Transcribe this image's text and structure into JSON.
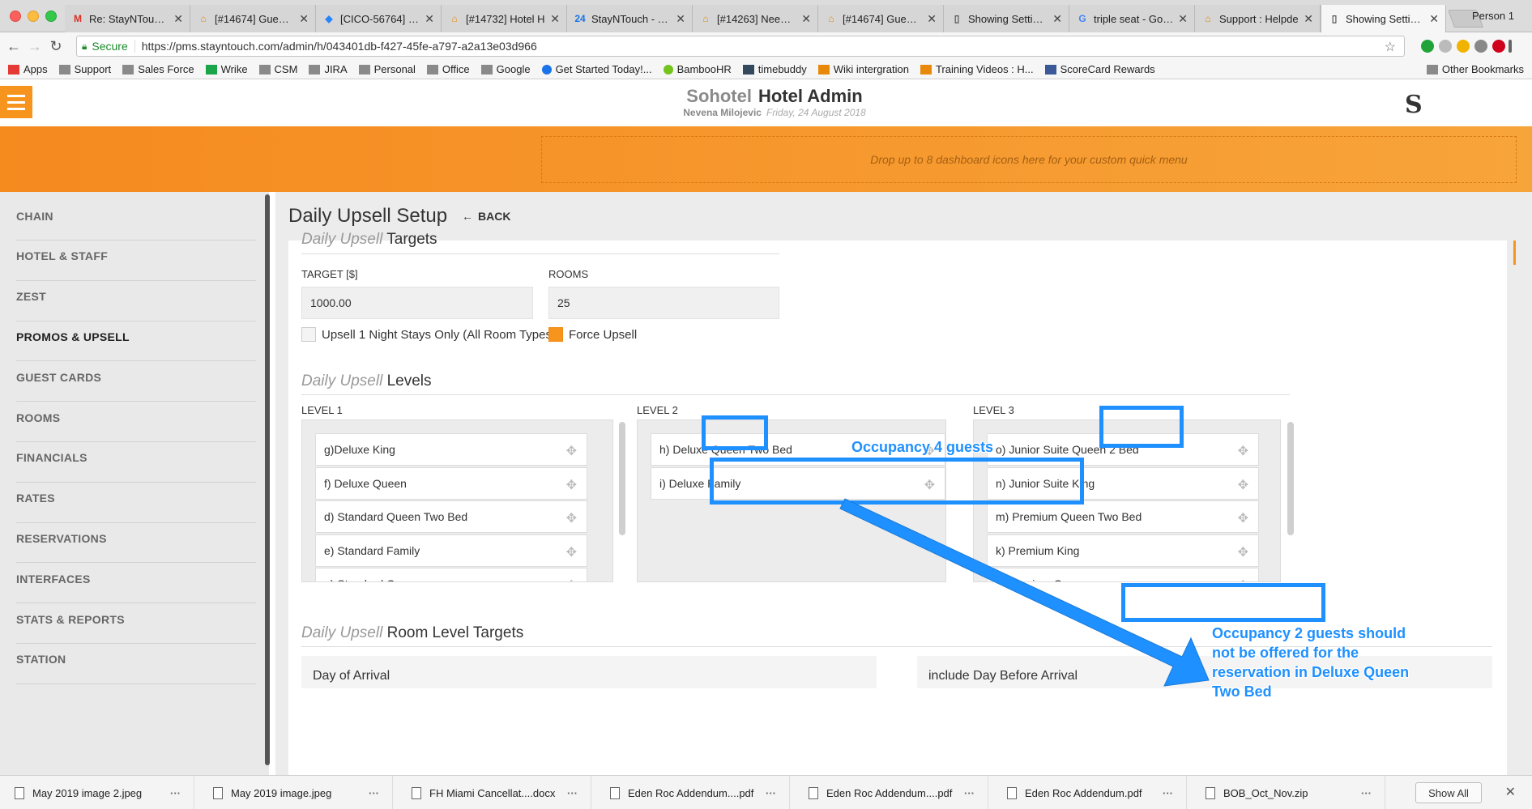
{
  "browser": {
    "tabs": [
      {
        "label": "Re: StayNTouch T",
        "icon": "gmail-icon",
        "icon_glyph": "M",
        "icon_color": "#d93025"
      },
      {
        "label": "[#14674] Guest d",
        "icon": "helpdesk-icon",
        "icon_glyph": "⌂",
        "icon_color": "#e8890c"
      },
      {
        "label": "[CICO-56764] Ho",
        "icon": "jira-icon",
        "icon_glyph": "◆",
        "icon_color": "#2684ff"
      },
      {
        "label": "[#14732] Hotel H",
        "icon": "helpdesk-icon",
        "icon_glyph": "⌂",
        "icon_color": "#e8890c"
      },
      {
        "label": "StayNTouch - Fric",
        "icon": "calendar-icon",
        "icon_glyph": "24",
        "icon_color": "#1a73e8"
      },
      {
        "label": "[#14263] Need to",
        "icon": "helpdesk-icon",
        "icon_glyph": "⌂",
        "icon_color": "#e8890c"
      },
      {
        "label": "[#14674] Guest d",
        "icon": "helpdesk-icon",
        "icon_glyph": "⌂",
        "icon_color": "#e8890c"
      },
      {
        "label": "Showing Settings",
        "icon": "document-icon",
        "icon_glyph": "▯",
        "icon_color": "#555555"
      },
      {
        "label": "triple seat - Goog",
        "icon": "google-icon",
        "icon_glyph": "G",
        "icon_color": "#4285f4"
      },
      {
        "label": "Support : Helpde",
        "icon": "helpdesk-icon",
        "icon_glyph": "⌂",
        "icon_color": "#e8890c"
      },
      {
        "label": "Showing Settings",
        "icon": "document-icon",
        "icon_glyph": "▯",
        "icon_color": "#555555",
        "active": true
      }
    ],
    "profile": "Person 1",
    "secure_label": "Secure",
    "url": "https://pms.stayntouch.com/admin/h/043401db-f427-45fe-a797-a2a13e03d966",
    "bookmarks": [
      {
        "label": "Apps",
        "icon": "apps-grid-icon"
      },
      {
        "label": "Support",
        "icon": "folder-icon"
      },
      {
        "label": "Sales Force",
        "icon": "folder-icon"
      },
      {
        "label": "Wrike",
        "icon": "checkmark-icon"
      },
      {
        "label": "CSM",
        "icon": "folder-icon"
      },
      {
        "label": "JIRA",
        "icon": "folder-icon"
      },
      {
        "label": "Personal",
        "icon": "folder-icon"
      },
      {
        "label": "Office",
        "icon": "folder-icon"
      },
      {
        "label": "Google",
        "icon": "folder-icon"
      },
      {
        "label": "Get Started Today!...",
        "icon": "search-icon"
      },
      {
        "label": "BambooHR",
        "icon": "bamboo-icon"
      },
      {
        "label": "timebuddy",
        "icon": "clock-icon"
      },
      {
        "label": "Wiki intergration",
        "icon": "helpdesk-icon"
      },
      {
        "label": "Training Videos : H...",
        "icon": "helpdesk-icon"
      },
      {
        "label": "ScoreCard Rewards",
        "icon": "scorecard-icon"
      }
    ],
    "other_bookmarks": "Other Bookmarks"
  },
  "header": {
    "hotel": "Sohotel",
    "title": "Hotel Admin",
    "user": "Nevena Milojevic",
    "date": "Friday, 24 August 2018",
    "drop_zone": "Drop up to 8 dashboard icons here for your custom quick menu"
  },
  "sidebar": {
    "items": [
      {
        "label": "CHAIN"
      },
      {
        "label": "HOTEL & STAFF"
      },
      {
        "label": "ZEST"
      },
      {
        "label": "PROMOS & UPSELL",
        "active": true
      },
      {
        "label": "GUEST CARDS"
      },
      {
        "label": "ROOMS"
      },
      {
        "label": "FINANCIALS"
      },
      {
        "label": "RATES"
      },
      {
        "label": "RESERVATIONS"
      },
      {
        "label": "INTERFACES"
      },
      {
        "label": "STATS & REPORTS"
      },
      {
        "label": "STATION"
      }
    ]
  },
  "page": {
    "title": "Daily Upsell Setup",
    "back": "BACK",
    "targets_title_light": "Daily Upsell",
    "targets_title": "Targets",
    "target_label": "TARGET [$]",
    "target_value": "1000.00",
    "rooms_label": "ROOMS",
    "rooms_value": "25",
    "night_stays_label": "Upsell 1 Night Stays Only (All Room Types)",
    "force_upsell_label": "Force Upsell",
    "levels_title_light": "Daily Upsell",
    "levels_title": "Levels",
    "levels": [
      {
        "label": "LEVEL 1",
        "items": [
          "g)Deluxe King",
          "f) Deluxe Queen",
          "d) Standard Queen Two Bed",
          "e) Standard Family",
          "a) Standard Queen"
        ]
      },
      {
        "label": "LEVEL 2",
        "items": [
          "h) Deluxe Queen Two Bed",
          "i) Deluxe Family"
        ]
      },
      {
        "label": "LEVEL 3",
        "items": [
          "o) Junior Suite Queen 2 Bed",
          "n) Junior Suite King",
          "m) Premium Queen Two Bed",
          "k) Premium King",
          "i) Premium Queen"
        ]
      }
    ],
    "room_targets_title_light": "Daily Upsell",
    "room_targets_title": "Room Level Targets",
    "day_of_arrival": "Day of Arrival",
    "day_before_arrival": "include Day Before Arrival"
  },
  "annotations": {
    "occupancy_4": "Occupancy 4 guests",
    "occupancy_2_lines": [
      "Occupancy 2 guests should",
      "not be offered for the",
      "reservation in Deluxe Queen",
      "Two Bed"
    ],
    "color": "#1e90ff"
  },
  "downloads": {
    "files": [
      "May 2019 image 2.jpeg",
      "May 2019 image.jpeg",
      "FH Miami Cancellat....docx",
      "Eden Roc Addendum....pdf",
      "Eden Roc Addendum....pdf",
      "Eden Roc Addendum.pdf",
      "BOB_Oct_Nov.zip"
    ],
    "show_all": "Show All"
  },
  "colors": {
    "accent": "#f7941d",
    "annotation": "#1e90ff"
  }
}
